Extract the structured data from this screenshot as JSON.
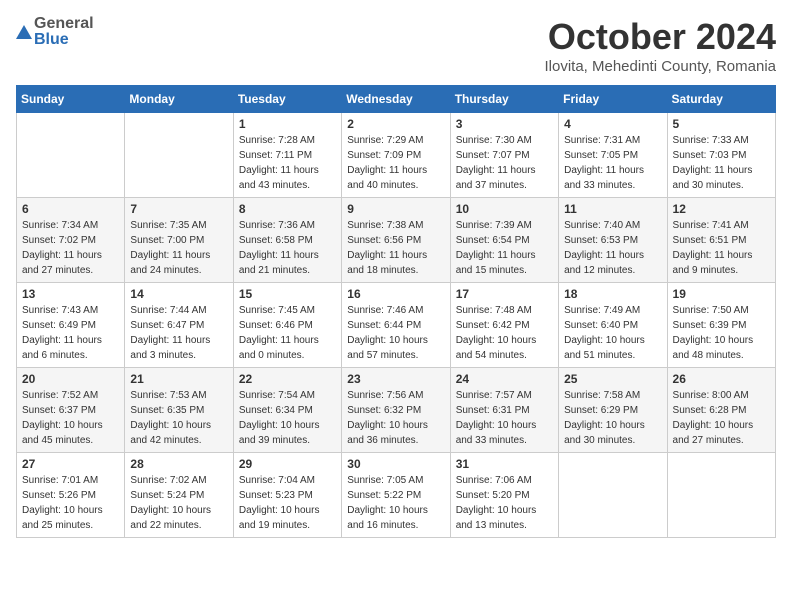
{
  "header": {
    "logo_top": "General",
    "logo_bottom": "Blue",
    "month": "October 2024",
    "location": "Ilovita, Mehedinti County, Romania"
  },
  "weekdays": [
    "Sunday",
    "Monday",
    "Tuesday",
    "Wednesday",
    "Thursday",
    "Friday",
    "Saturday"
  ],
  "weeks": [
    [
      {
        "day": "",
        "info": ""
      },
      {
        "day": "",
        "info": ""
      },
      {
        "day": "1",
        "info": "Sunrise: 7:28 AM\nSunset: 7:11 PM\nDaylight: 11 hours and 43 minutes."
      },
      {
        "day": "2",
        "info": "Sunrise: 7:29 AM\nSunset: 7:09 PM\nDaylight: 11 hours and 40 minutes."
      },
      {
        "day": "3",
        "info": "Sunrise: 7:30 AM\nSunset: 7:07 PM\nDaylight: 11 hours and 37 minutes."
      },
      {
        "day": "4",
        "info": "Sunrise: 7:31 AM\nSunset: 7:05 PM\nDaylight: 11 hours and 33 minutes."
      },
      {
        "day": "5",
        "info": "Sunrise: 7:33 AM\nSunset: 7:03 PM\nDaylight: 11 hours and 30 minutes."
      }
    ],
    [
      {
        "day": "6",
        "info": "Sunrise: 7:34 AM\nSunset: 7:02 PM\nDaylight: 11 hours and 27 minutes."
      },
      {
        "day": "7",
        "info": "Sunrise: 7:35 AM\nSunset: 7:00 PM\nDaylight: 11 hours and 24 minutes."
      },
      {
        "day": "8",
        "info": "Sunrise: 7:36 AM\nSunset: 6:58 PM\nDaylight: 11 hours and 21 minutes."
      },
      {
        "day": "9",
        "info": "Sunrise: 7:38 AM\nSunset: 6:56 PM\nDaylight: 11 hours and 18 minutes."
      },
      {
        "day": "10",
        "info": "Sunrise: 7:39 AM\nSunset: 6:54 PM\nDaylight: 11 hours and 15 minutes."
      },
      {
        "day": "11",
        "info": "Sunrise: 7:40 AM\nSunset: 6:53 PM\nDaylight: 11 hours and 12 minutes."
      },
      {
        "day": "12",
        "info": "Sunrise: 7:41 AM\nSunset: 6:51 PM\nDaylight: 11 hours and 9 minutes."
      }
    ],
    [
      {
        "day": "13",
        "info": "Sunrise: 7:43 AM\nSunset: 6:49 PM\nDaylight: 11 hours and 6 minutes."
      },
      {
        "day": "14",
        "info": "Sunrise: 7:44 AM\nSunset: 6:47 PM\nDaylight: 11 hours and 3 minutes."
      },
      {
        "day": "15",
        "info": "Sunrise: 7:45 AM\nSunset: 6:46 PM\nDaylight: 11 hours and 0 minutes."
      },
      {
        "day": "16",
        "info": "Sunrise: 7:46 AM\nSunset: 6:44 PM\nDaylight: 10 hours and 57 minutes."
      },
      {
        "day": "17",
        "info": "Sunrise: 7:48 AM\nSunset: 6:42 PM\nDaylight: 10 hours and 54 minutes."
      },
      {
        "day": "18",
        "info": "Sunrise: 7:49 AM\nSunset: 6:40 PM\nDaylight: 10 hours and 51 minutes."
      },
      {
        "day": "19",
        "info": "Sunrise: 7:50 AM\nSunset: 6:39 PM\nDaylight: 10 hours and 48 minutes."
      }
    ],
    [
      {
        "day": "20",
        "info": "Sunrise: 7:52 AM\nSunset: 6:37 PM\nDaylight: 10 hours and 45 minutes."
      },
      {
        "day": "21",
        "info": "Sunrise: 7:53 AM\nSunset: 6:35 PM\nDaylight: 10 hours and 42 minutes."
      },
      {
        "day": "22",
        "info": "Sunrise: 7:54 AM\nSunset: 6:34 PM\nDaylight: 10 hours and 39 minutes."
      },
      {
        "day": "23",
        "info": "Sunrise: 7:56 AM\nSunset: 6:32 PM\nDaylight: 10 hours and 36 minutes."
      },
      {
        "day": "24",
        "info": "Sunrise: 7:57 AM\nSunset: 6:31 PM\nDaylight: 10 hours and 33 minutes."
      },
      {
        "day": "25",
        "info": "Sunrise: 7:58 AM\nSunset: 6:29 PM\nDaylight: 10 hours and 30 minutes."
      },
      {
        "day": "26",
        "info": "Sunrise: 8:00 AM\nSunset: 6:28 PM\nDaylight: 10 hours and 27 minutes."
      }
    ],
    [
      {
        "day": "27",
        "info": "Sunrise: 7:01 AM\nSunset: 5:26 PM\nDaylight: 10 hours and 25 minutes."
      },
      {
        "day": "28",
        "info": "Sunrise: 7:02 AM\nSunset: 5:24 PM\nDaylight: 10 hours and 22 minutes."
      },
      {
        "day": "29",
        "info": "Sunrise: 7:04 AM\nSunset: 5:23 PM\nDaylight: 10 hours and 19 minutes."
      },
      {
        "day": "30",
        "info": "Sunrise: 7:05 AM\nSunset: 5:22 PM\nDaylight: 10 hours and 16 minutes."
      },
      {
        "day": "31",
        "info": "Sunrise: 7:06 AM\nSunset: 5:20 PM\nDaylight: 10 hours and 13 minutes."
      },
      {
        "day": "",
        "info": ""
      },
      {
        "day": "",
        "info": ""
      }
    ]
  ]
}
